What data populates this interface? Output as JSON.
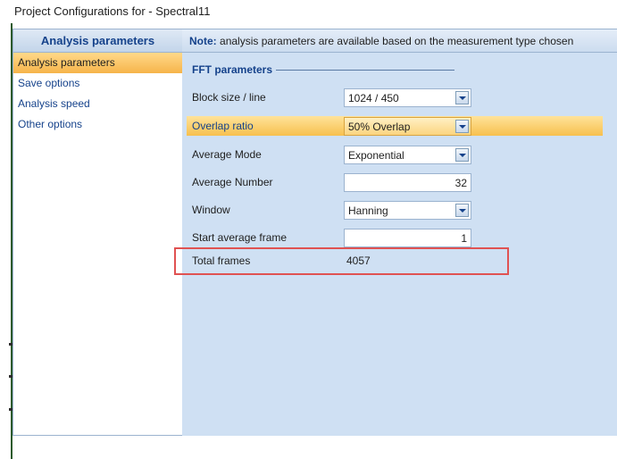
{
  "window": {
    "title": "Project Configurations for - Spectral11"
  },
  "sidebar": {
    "header": "Analysis parameters",
    "items": [
      {
        "label": "Analysis parameters",
        "active": true
      },
      {
        "label": "Save options",
        "active": false
      },
      {
        "label": "Analysis speed",
        "active": false
      },
      {
        "label": "Other options",
        "active": false
      }
    ]
  },
  "main": {
    "note_label": "Note:",
    "note_text": "analysis parameters are available based on the measurement type chosen",
    "group_title": "FFT parameters",
    "fields": {
      "block_size": {
        "label": "Block size / line",
        "value": "1024 / 450"
      },
      "overlap_ratio": {
        "label": "Overlap ratio",
        "value": "50% Overlap"
      },
      "average_mode": {
        "label": "Average Mode",
        "value": "Exponential"
      },
      "average_number": {
        "label": "Average Number",
        "value": "32"
      },
      "window": {
        "label": "Window",
        "value": "Hanning"
      },
      "start_average_frame": {
        "label": "Start average frame",
        "value": "1"
      },
      "total_frames": {
        "label": "Total frames",
        "value": "4057"
      }
    }
  },
  "colors": {
    "highlight": "#f7c04e",
    "panel": "#cfe0f3",
    "accent": "#15428b",
    "callout": "#e05252"
  }
}
